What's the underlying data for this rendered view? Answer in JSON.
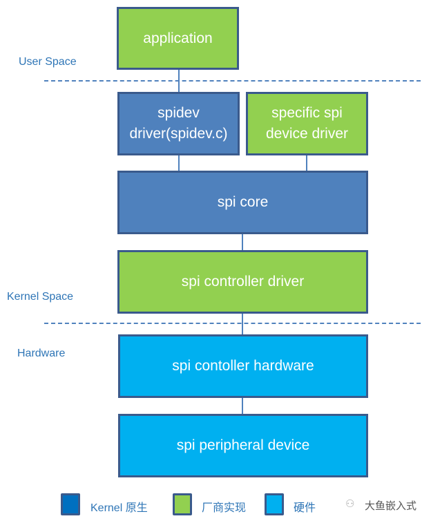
{
  "zones": {
    "user_space": "User Space",
    "kernel_space": "Kernel Space",
    "hardware": "Hardware"
  },
  "boxes": {
    "application": "application",
    "spidev_driver": "spidev\ndriver(spidev.c)",
    "specific_driver": "specific spi\ndevice driver",
    "spi_core": "spi core",
    "controller_driver": "spi controller driver",
    "controller_hardware": "spi contoller hardware",
    "peripheral_device": "spi peripheral device"
  },
  "legend": [
    {
      "label": "Kernel 原生",
      "color": "#0070c0"
    },
    {
      "label": "厂商实现",
      "color": "#92d050"
    },
    {
      "label": "硬件",
      "color": "#00b0f0"
    }
  ],
  "watermark": "大鱼嵌入式"
}
